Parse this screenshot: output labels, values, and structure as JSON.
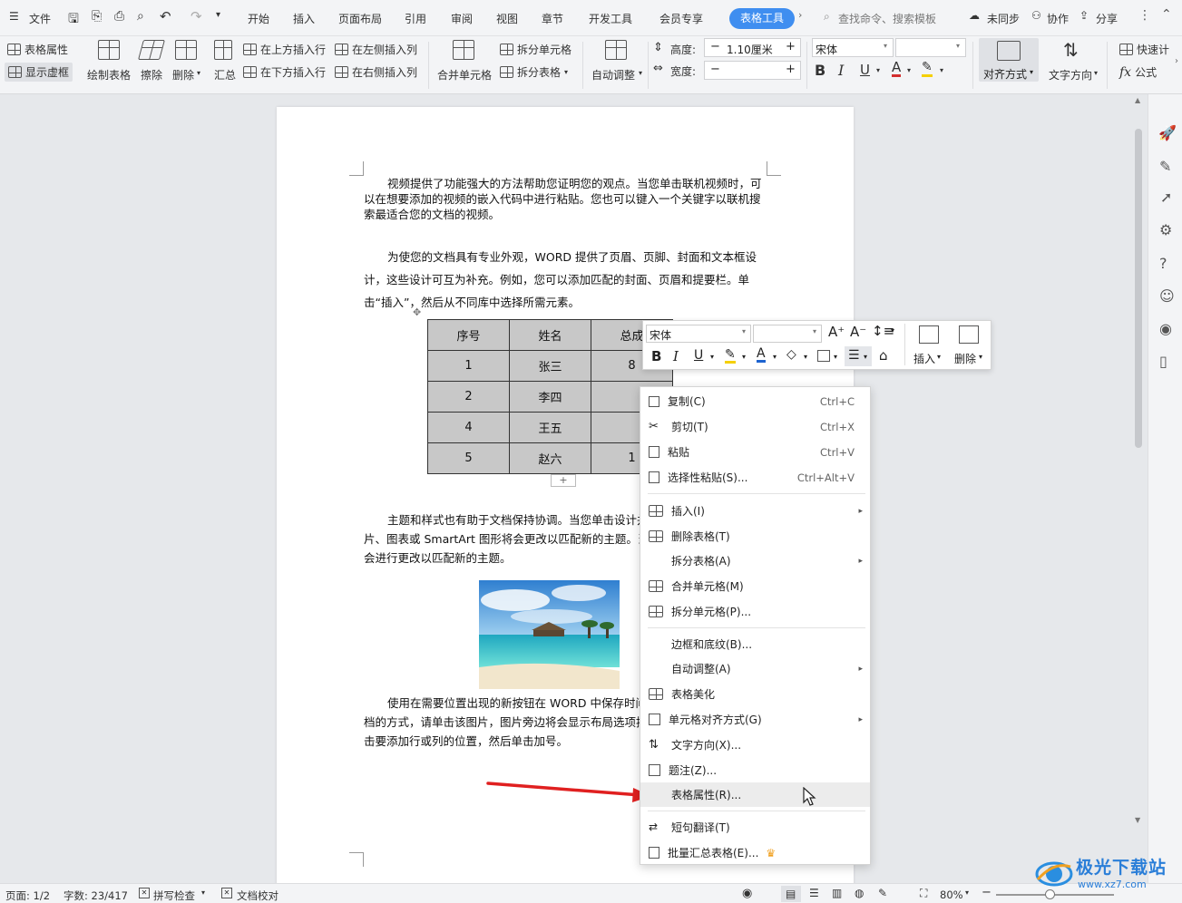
{
  "menubar": {
    "file_label": "文件",
    "tabs": [
      "开始",
      "插入",
      "页面布局",
      "引用",
      "审阅",
      "视图",
      "章节",
      "开发工具",
      "会员专享"
    ],
    "active_tab": "表格工具",
    "search_placeholder": "查找命令、搜索模板",
    "sync_label": "未同步",
    "collab_label": "协作",
    "share_label": "分享"
  },
  "ribbon": {
    "table_props": "表格属性",
    "show_gridlines": "显示虚框",
    "draw_table": "绘制表格",
    "erase": "擦除",
    "delete": "删除",
    "summary": "汇总",
    "insert_above": "在上方插入行",
    "insert_below": "在下方插入行",
    "insert_left": "在左侧插入列",
    "insert_right": "在右侧插入列",
    "merge_cells": "合并单元格",
    "split_cells": "拆分单元格",
    "split_table": "拆分表格",
    "auto_fit": "自动调整",
    "height_label": "高度:",
    "height_value": "1.10厘米",
    "width_label": "宽度:",
    "font_name": "宋体",
    "align": "对齐方式",
    "text_direction": "文字方向",
    "quick_calc": "快速计",
    "formula": "公式"
  },
  "document": {
    "para1": "视频提供了功能强大的方法帮助您证明您的观点。当您单击联机视频时，可以在想要添加的视频的嵌入代码中进行粘贴。您也可以键入一个关键字以联机搜索最适合您的文档的视频。",
    "para2": "为使您的文档具有专业外观，WORD 提供了页眉、页脚、封面和文本框设计，这些设计可互为补充。例如，您可以添加匹配的封面、页眉和提要栏。单击“插入”，然后从不同库中选择所需元素。",
    "para3": "主题和样式也有助于文档保持协调。当您单击设计并选择新的主题时，图片、图表或 SmartArt 图形将会更改以匹配新的主题。当应用样式时，您的标题会进行更改以匹配新的主题。",
    "para4": "使用在需要位置出现的新按钮在 WORD 中保存时间。若要更改图片适应文档的方式，请单击该图片，图片旁边将会显示布局选项按钮。当处理表格时，单击要添加行或列的位置，然后单击加号。",
    "table": {
      "headers": [
        "序号",
        "姓名",
        "总成"
      ],
      "rows": [
        [
          "1",
          "张三",
          "8"
        ],
        [
          "2",
          "李四",
          ""
        ],
        [
          "4",
          "王五",
          ""
        ],
        [
          "5",
          "赵六",
          "1"
        ]
      ]
    }
  },
  "mini_toolbar": {
    "font": "宋体",
    "insert_label": "插入",
    "delete_label": "删除"
  },
  "context_menu": {
    "items": [
      {
        "label": "复制(C)",
        "shortcut": "Ctrl+C"
      },
      {
        "label": "剪切(T)",
        "shortcut": "Ctrl+X"
      },
      {
        "label": "粘贴",
        "shortcut": "Ctrl+V"
      },
      {
        "label": "选择性粘贴(S)...",
        "shortcut": "Ctrl+Alt+V"
      },
      {
        "label": "插入(I)"
      },
      {
        "label": "删除表格(T)"
      },
      {
        "label": "拆分表格(A)"
      },
      {
        "label": "合并单元格(M)"
      },
      {
        "label": "拆分单元格(P)..."
      },
      {
        "label": "边框和底纹(B)..."
      },
      {
        "label": "自动调整(A)"
      },
      {
        "label": "表格美化"
      },
      {
        "label": "单元格对齐方式(G)"
      },
      {
        "label": "文字方向(X)..."
      },
      {
        "label": "题注(Z)..."
      },
      {
        "label": "表格属性(R)..."
      },
      {
        "label": "短句翻译(T)"
      },
      {
        "label": "批量汇总表格(E)..."
      }
    ]
  },
  "statusbar": {
    "page": "页面: 1/2",
    "words": "字数: 23/417",
    "spell": "拼写检查",
    "proof": "文档校对",
    "zoom": "80%"
  },
  "watermark": {
    "site": "极光下载站",
    "url": "www.xz7.com"
  },
  "colors": {
    "accent": "#3f8ef0",
    "arrow": "#e02020",
    "table_fill": "#c8c8c8"
  }
}
